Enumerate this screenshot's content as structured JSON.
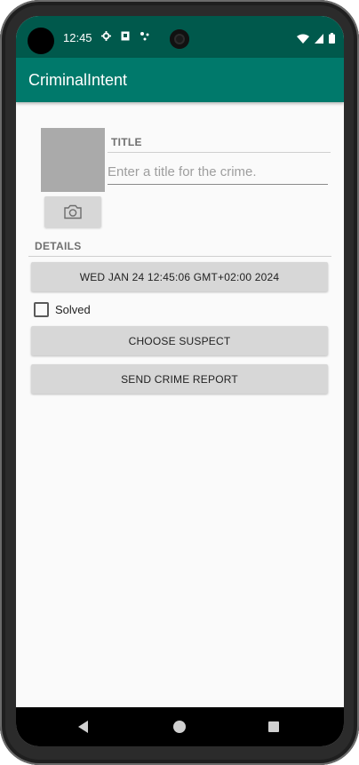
{
  "status_bar": {
    "time": "12:45",
    "left_icons": [
      "gear-icon",
      "sim-icon",
      "data-saver-icon"
    ],
    "right_icons": [
      "wifi-icon",
      "signal-icon",
      "battery-icon"
    ]
  },
  "app_bar": {
    "title": "CriminalIntent",
    "color": "#00796b",
    "status_color": "#00594c"
  },
  "crime": {
    "title_label": "TITLE",
    "title_placeholder": "Enter a title for the crime.",
    "title_value": "",
    "details_label": "DETAILS",
    "date_button": "WED JAN 24 12:45:06 GMT+02:00 2024",
    "solved_label": "Solved",
    "solved_checked": false,
    "choose_suspect_button": "CHOOSE SUSPECT",
    "send_report_button": "SEND CRIME REPORT"
  },
  "nav_bar": {
    "buttons": [
      "back-icon",
      "home-icon",
      "recents-icon"
    ]
  }
}
